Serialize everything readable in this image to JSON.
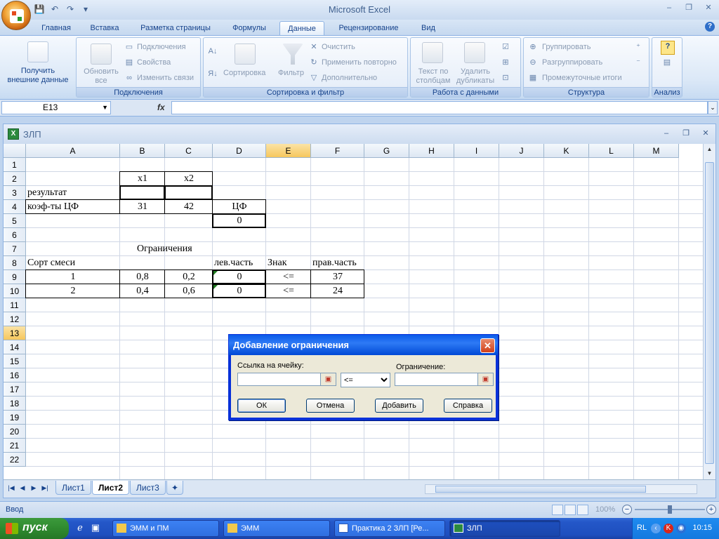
{
  "app": {
    "title": "Microsoft Excel",
    "window_controls": {
      "minimize": "–",
      "restore": "❐",
      "close": "✕"
    }
  },
  "qat": {
    "save": "💾",
    "undo": "↶",
    "redo": "↷",
    "customize": "▾"
  },
  "ribbon_tabs": [
    {
      "label": "Главная",
      "active": false
    },
    {
      "label": "Вставка",
      "active": false
    },
    {
      "label": "Разметка страницы",
      "active": false
    },
    {
      "label": "Формулы",
      "active": false
    },
    {
      "label": "Данные",
      "active": true
    },
    {
      "label": "Рецензирование",
      "active": false
    },
    {
      "label": "Вид",
      "active": false
    }
  ],
  "ribbon": {
    "get_external": "Получить\nвнешние данные",
    "connections_group": {
      "label": "Подключения",
      "refresh": "Обновить\nвсе",
      "connections": "Подключения",
      "properties": "Свойства",
      "edit_links": "Изменить связи"
    },
    "sort_group": {
      "label": "Сортировка и фильтр",
      "sort": "Сортировка",
      "filter": "Фильтр",
      "clear": "Очистить",
      "reapply": "Применить повторно",
      "advanced": "Дополнительно"
    },
    "data_tools_group": {
      "label": "Работа с данными",
      "text_to_columns": "Текст по\nстолбцам",
      "remove_duplicates": "Удалить\nдубликаты"
    },
    "outline_group": {
      "label": "Структура",
      "group": "Группировать",
      "ungroup": "Разгруппировать",
      "subtotal": "Промежуточные итоги"
    },
    "analysis_group": {
      "label": "Анализ"
    }
  },
  "formula_bar": {
    "name_box": "E13",
    "fx": "fx",
    "content": ""
  },
  "workbook": {
    "title": "ЗЛП",
    "columns": [
      "A",
      "B",
      "C",
      "D",
      "E",
      "F",
      "G",
      "H",
      "I",
      "J",
      "K",
      "L",
      "M"
    ],
    "rows": [
      "1",
      "2",
      "3",
      "4",
      "5",
      "6",
      "7",
      "8",
      "9",
      "10",
      "11",
      "12",
      "13",
      "14",
      "15",
      "16",
      "17",
      "18",
      "19",
      "20",
      "21",
      "22"
    ],
    "selected_col": "E",
    "selected_row": "13",
    "cells": {
      "B2": "x1",
      "C2": "x2",
      "A3": "результат",
      "A4": "коэф-ты ЦФ",
      "B4": "31",
      "C4": "42",
      "D4": "ЦФ",
      "D5": "0",
      "B7": "Ограничения",
      "A8": "Сорт смеси",
      "D8": "лев.часть",
      "E8": "Знак",
      "F8": "прав.часть",
      "A9": "1",
      "B9": "0,8",
      "C9": "0,2",
      "D9": "0",
      "E9": "<=",
      "F9": "37",
      "A10": "2",
      "B10": "0,4",
      "C10": "0,6",
      "D10": "0",
      "E10": "<=",
      "F10": "24"
    },
    "sheets": [
      {
        "label": "Лист1",
        "active": false
      },
      {
        "label": "Лист2",
        "active": true
      },
      {
        "label": "Лист3",
        "active": false
      }
    ]
  },
  "dialog": {
    "title": "Добавление ограничения",
    "cell_ref_label": "Ссылка на ячейку:",
    "constraint_label": "Ограничение:",
    "cell_ref_value": "",
    "constraint_value": "",
    "operator": "<=",
    "buttons": {
      "ok": "ОК",
      "cancel": "Отмена",
      "add": "Добавить",
      "help": "Справка"
    }
  },
  "status_bar": {
    "mode": "Ввод",
    "zoom": "100%"
  },
  "taskbar": {
    "start": "пуск",
    "tasks": [
      {
        "label": "ЭММ и ПМ",
        "active": false
      },
      {
        "label": "ЭММ",
        "active": false
      },
      {
        "label": "Практика 2 ЗЛП [Ре...",
        "active": false
      },
      {
        "label": "ЗЛП",
        "active": true
      }
    ],
    "lang": "RL",
    "clock": "10:15"
  },
  "colors": {
    "accent": "#15428b",
    "dialog_title": "#0a5ae8",
    "start_green": "#2f8a2f"
  }
}
